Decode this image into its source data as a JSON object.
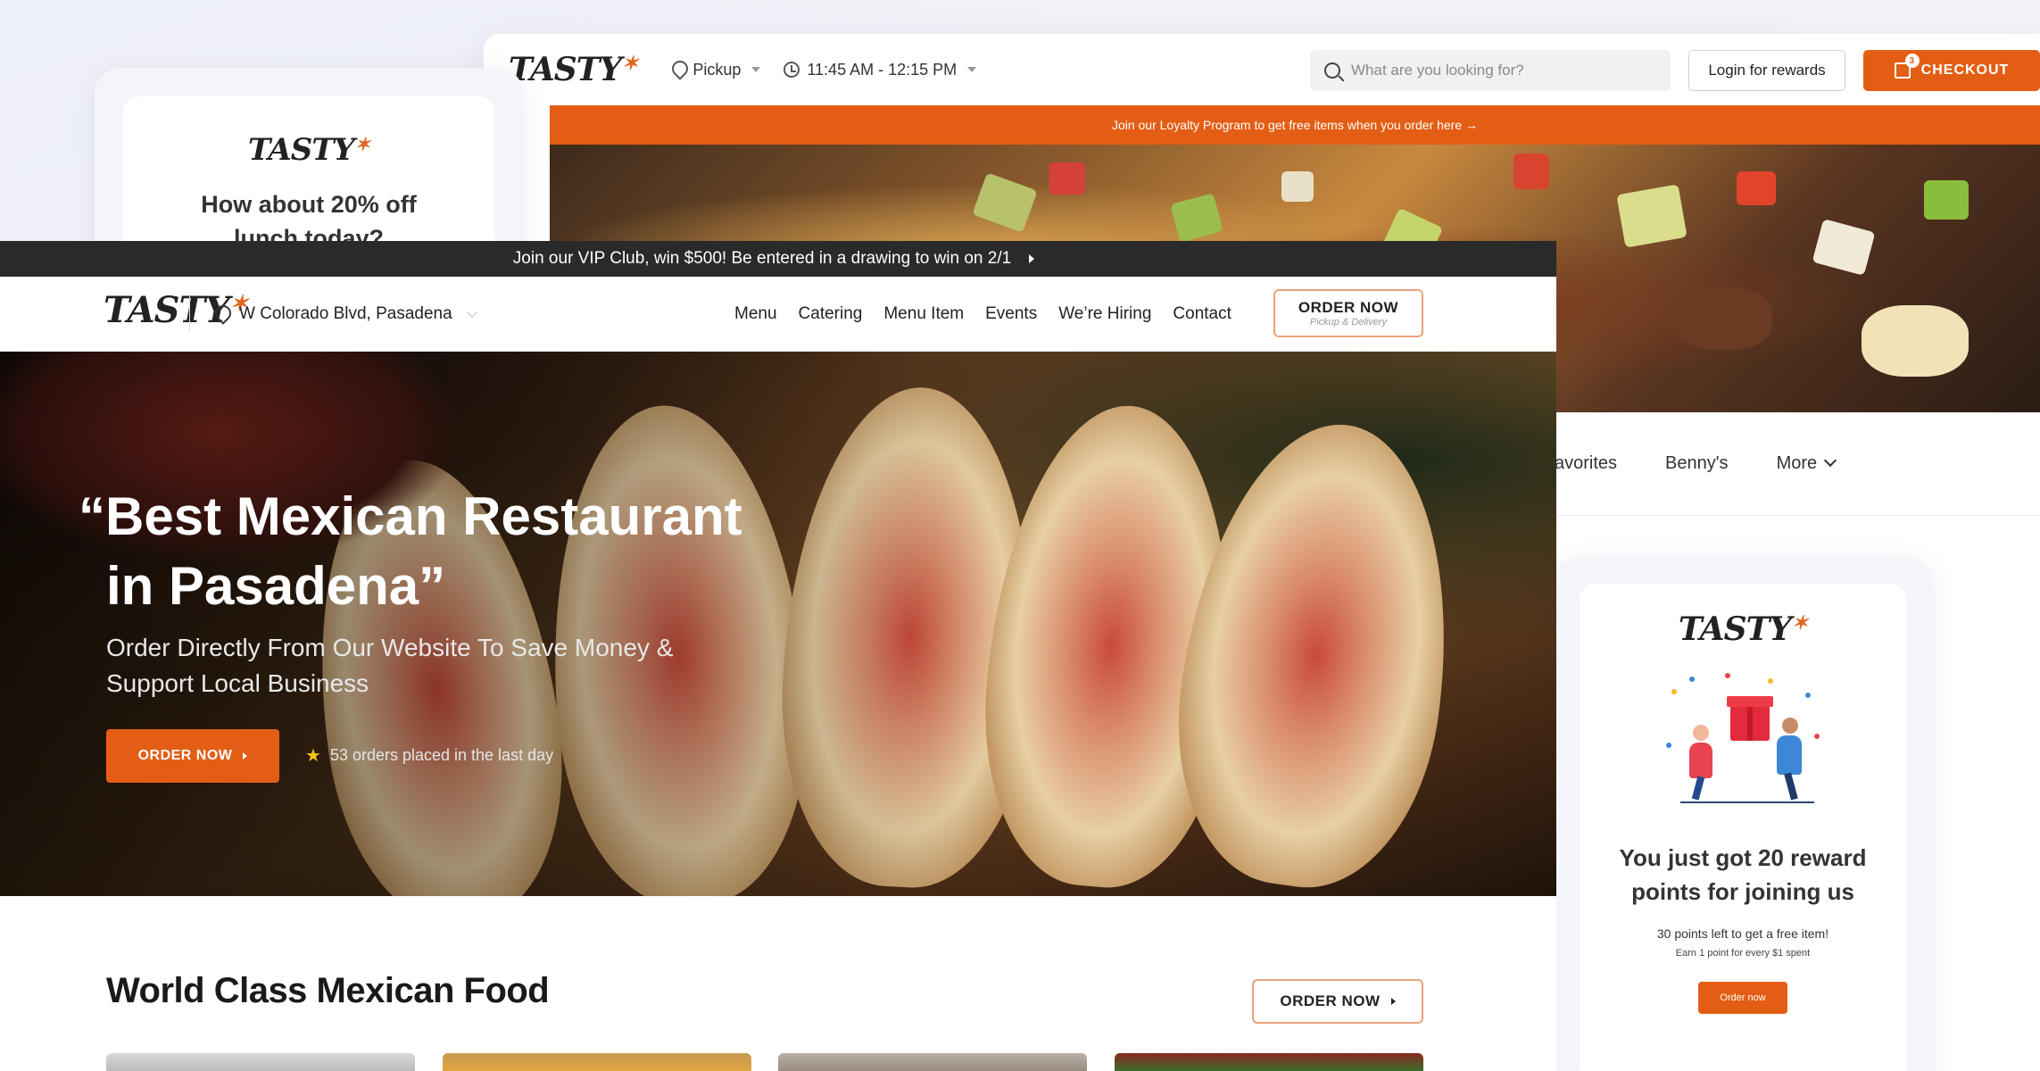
{
  "back_window": {
    "logo": "TASTY",
    "pickup_label": "Pickup",
    "time_label": "11:45 AM - 12:15 PM",
    "search_placeholder": "What are you looking for?",
    "login_label": "Login for rewards",
    "checkout_label": "CHECKOUT",
    "cart_count": "3",
    "loyalty_banner": "Join our Loyalty Program to get free items when you order here →",
    "nav": [
      "avorites",
      "Benny's",
      "More"
    ]
  },
  "promo_card": {
    "logo": "TASTY",
    "title": "How about 20% off lunch today?"
  },
  "reward_card": {
    "logo": "TASTY",
    "title": "You just got 20 reward points for joining us",
    "subtitle": "30 points left to get a free item!",
    "earn_note": "Earn 1 point for every $1 spent",
    "button_label": "Order now"
  },
  "front": {
    "vip_banner": "Join our VIP Club, win $500! Be entered in a drawing to win on 2/1",
    "logo": "TASTY",
    "location": "W Colorado Blvd, Pasadena",
    "nav_links": [
      "Menu",
      "Catering",
      "Menu Item",
      "Events",
      "We’re Hiring",
      "Contact"
    ],
    "order_now": {
      "title": "ORDER NOW",
      "subtitle": "Pickup & Delivery"
    },
    "hero": {
      "title_line1": "“Best Mexican Restaurant",
      "title_line2": "in Pasadena”",
      "subtitle": "Order Directly From Our Website To Save Money & Support Local Business",
      "button_label": "ORDER NOW",
      "stat": "53 orders placed in the last day"
    },
    "section": {
      "title": "World Class Mexican Food",
      "button_label": "ORDER NOW"
    }
  },
  "colors": {
    "accent": "#e35e14",
    "vip_bar": "#2a2a2a",
    "star": "#f5c518"
  }
}
